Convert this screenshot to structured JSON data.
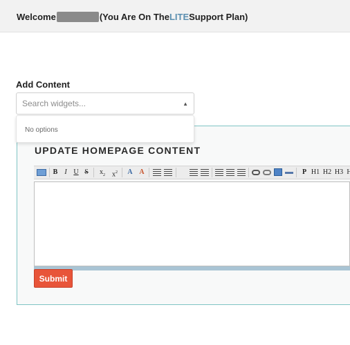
{
  "header": {
    "welcome_prefix": "Welcome",
    "plan_open": "(You Are On The ",
    "plan_name": "LITE",
    "plan_close": " Support Plan)"
  },
  "add_content": {
    "label": "Add Content",
    "search_placeholder": "Search widgets...",
    "no_options_text": "No options"
  },
  "panel": {
    "title": "UPDATE HOMEPAGE CONTENT",
    "toolbar_text_buttons": {
      "bold": "B",
      "italic": "I",
      "underline": "U",
      "strike": "S",
      "subscript": "x",
      "superscript": "x",
      "paragraph": "P",
      "h1": "H1",
      "h2": "H2",
      "h3": "H3",
      "h4": "H"
    },
    "submit_label": "Submit"
  },
  "colors": {
    "accent_lite": "#5b8fb0",
    "panel_border": "#7ec4c4",
    "submit_bg": "#e8553a"
  }
}
